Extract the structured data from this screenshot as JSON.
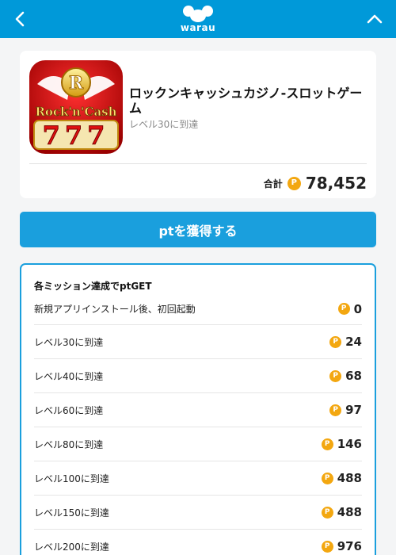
{
  "header": {
    "logo_text": "warau",
    "back_icon": "chevron-left-icon",
    "collapse_icon": "chevron-up-icon",
    "color": "#0099d9"
  },
  "app": {
    "icon_text_top": "R",
    "icon_text_mid": "Rock'n'Cash",
    "icon_text_bot": "777",
    "title": "ロックンキャッシュカジノ-スロットゲーム",
    "subtitle": "レベル30に到達",
    "total_label": "合計",
    "total_value": "78,452"
  },
  "coin_symbol": "P",
  "cta": {
    "label": "ptを獲得する",
    "color": "#1a9fdd"
  },
  "missions": {
    "heading": "各ミッション達成でptGET",
    "items": [
      {
        "label": "新規アプリインストール後、初回起動",
        "points": "0"
      },
      {
        "label": "レベル30に到達",
        "points": "24"
      },
      {
        "label": "レベル40に到達",
        "points": "68"
      },
      {
        "label": "レベル60に到達",
        "points": "97"
      },
      {
        "label": "レベル80に到達",
        "points": "146"
      },
      {
        "label": "レベル100に到達",
        "points": "488"
      },
      {
        "label": "レベル150に到達",
        "points": "488"
      },
      {
        "label": "レベル200に到達",
        "points": "976"
      }
    ]
  }
}
